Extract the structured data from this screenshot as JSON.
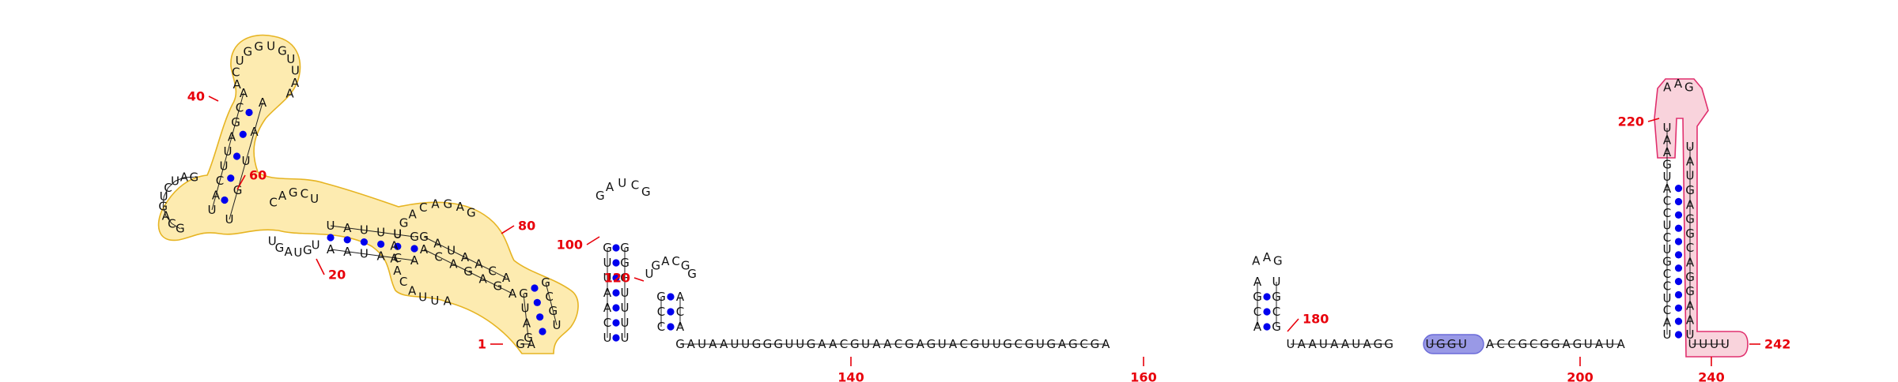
{
  "colors": {
    "background": "#ffffff",
    "nucleotide": "#111111",
    "base_pair_dot": "#0000ee",
    "position_label": "#e8000b",
    "highlight_yellow_fill": "#fdebb0",
    "highlight_yellow_stroke": "#e6b422",
    "highlight_pink_fill": "#f9d3dc",
    "highlight_pink_stroke": "#e0306e",
    "highlight_blue_fill": "#9999e6",
    "highlight_blue_stroke": "#6a6ad8"
  },
  "diagram": {
    "position_labels": [
      {
        "id": "pos-1",
        "text": "1"
      },
      {
        "id": "pos-20",
        "text": "20"
      },
      {
        "id": "pos-40",
        "text": "40"
      },
      {
        "id": "pos-60",
        "text": "60"
      },
      {
        "id": "pos-80",
        "text": "80"
      },
      {
        "id": "pos-100",
        "text": "100"
      },
      {
        "id": "pos-120",
        "text": "120"
      },
      {
        "id": "pos-140",
        "text": "140"
      },
      {
        "id": "pos-160",
        "text": "160"
      },
      {
        "id": "pos-180",
        "text": "180"
      },
      {
        "id": "pos-200",
        "text": "200"
      },
      {
        "id": "pos-220",
        "text": "220"
      },
      {
        "id": "pos-240",
        "text": "240"
      },
      {
        "id": "pos-242",
        "text": "242"
      }
    ],
    "tail_a": "GAUAAUUGGGUUGAACGUAACGAGUACGUUGCGUGAGCGA",
    "tail_b": "UAAUAAUAGG",
    "tail_blue": "UGGU",
    "tail_c": "ACCGCGGAGUAUA",
    "tail_end": "UUUU",
    "hp1_left": "UCAAUUG",
    "hp1_loop": "GAUCG",
    "hp1_right": "UUUUGGG",
    "hp2_left": "CCGUGA",
    "hp2_right": "ACACGG",
    "hp3_left": "ACGAA",
    "hp3_right": "GCGUU",
    "hp4_left": "UACUCCGUCUCCAUGAAU",
    "hp4_loop": "AAG",
    "hp4_right": "UAAGGACGGAGUAU",
    "leader": "GAUG",
    "domain_text": {
      "stem_lower_left": "GCGUCAGAGU",
      "stem_lower_right": "GAAGAUGACA",
      "loop_lower": "AUUACAAAUGACAGAG",
      "stem_mid_left": "UAUUUG",
      "stem_mid_right": "AAUACA",
      "loop_mid": "CAGCU",
      "loop_mid_bottom": "UGUAGU",
      "arm_left": "UACUUAGCA",
      "arm_right": "UGUAA",
      "arm_top": "ACUGGUGUUAA",
      "left_loop": "GCAGUCUAG"
    }
  }
}
